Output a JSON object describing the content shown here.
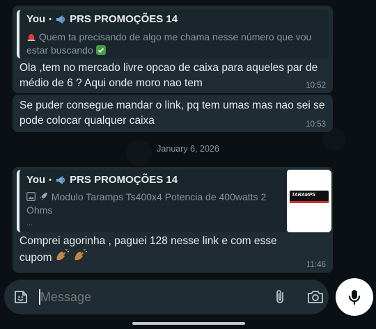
{
  "messages": [
    {
      "quote": {
        "author": "You",
        "separator": "•",
        "group": "PRS PROMOÇÕES 14",
        "text": "Quem ta precisando de algo me chama nesse número que vou estar buscando"
      },
      "text": "Ola ,tem no mercado livre opcao de caixa para aqueles par de médio de 6 ? Aqui onde moro nao tem",
      "time": "10:52"
    },
    {
      "text": "Se puder consegue mandar o link,  pq tem umas mas nao sei se pode colocar qualquer caixa",
      "time": "10:53"
    },
    {
      "quote": {
        "author": "You",
        "separator": "•",
        "group": "PRS PROMOÇÕES 14",
        "text": "Modulo Taramps Ts400x4 Potencia de 400watts 2 Ohms",
        "more": "...",
        "thumb_label": "TARAMPS"
      },
      "text": "Comprei agorinha ,  paguei 128 nesse link e com esse cupom",
      "time": "11:46"
    }
  ],
  "date_separator": "January 6, 2026",
  "composer": {
    "placeholder": "Message"
  },
  "icons": {
    "emoji": "sticker-icon",
    "attach": "paperclip-icon",
    "camera": "camera-icon",
    "mic": "mic-icon"
  },
  "colors": {
    "background": "#0b1014",
    "bubble": "#1f2c33",
    "quote_bg": "#1a252c",
    "text": "#e9edef",
    "secondary_text": "#8696a0",
    "mic_button": "#ffffff"
  }
}
